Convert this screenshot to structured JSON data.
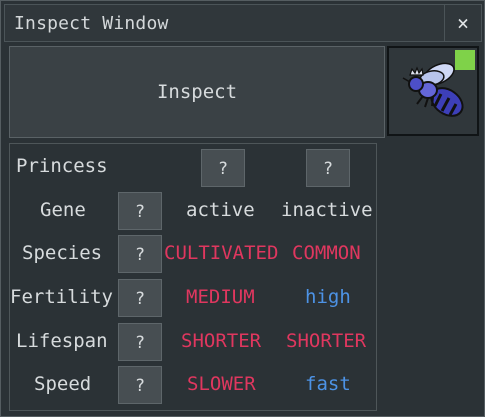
{
  "window": {
    "title": "Inspect Window",
    "close_glyph": "×"
  },
  "inspect_button": {
    "label": "Inspect"
  },
  "slot": {
    "item_icon": "bee-icon",
    "badge_color": "#7fd249"
  },
  "rows": {
    "princess": {
      "label": "Princess",
      "active_btn": "?",
      "inactive_btn": "?"
    },
    "gene": {
      "label": "Gene",
      "btn": "?",
      "active": "active",
      "inactive": "inactive"
    },
    "species": {
      "label": "Species",
      "btn": "?",
      "active": "CULTIVATED",
      "inactive": "COMMON"
    },
    "fertility": {
      "label": "Fertility",
      "btn": "?",
      "active": "MEDIUM",
      "inactive": "high"
    },
    "lifespan": {
      "label": "Lifespan",
      "btn": "?",
      "active": "SHORTER",
      "inactive": "SHORTER"
    },
    "speed": {
      "label": "Speed",
      "btn": "?",
      "active": "SLOWER",
      "inactive": "fast"
    }
  },
  "colors": {
    "dominant": "#e0375f",
    "recessive": "#4d93e6"
  }
}
